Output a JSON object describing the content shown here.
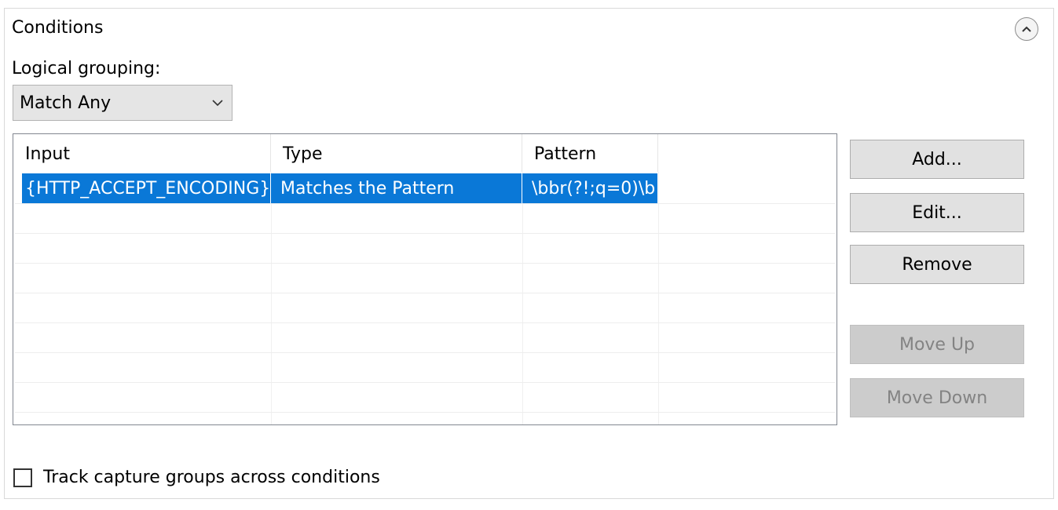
{
  "panel": {
    "title": "Conditions"
  },
  "logical_grouping": {
    "label": "Logical grouping:",
    "selected": "Match Any"
  },
  "table": {
    "columns": [
      "Input",
      "Type",
      "Pattern"
    ],
    "rows": [
      [
        "{HTTP_ACCEPT_ENCODING}",
        "Matches the Pattern",
        "\\bbr(?!;q=0)\\b"
      ]
    ]
  },
  "buttons": {
    "add": "Add...",
    "edit": "Edit...",
    "remove": "Remove",
    "move_up": "Move Up",
    "move_down": "Move Down"
  },
  "track_capture": {
    "label": "Track capture groups across conditions",
    "checked": false
  },
  "icons": {
    "collapse": "chevron-up-icon",
    "dropdown": "chevron-down-icon"
  },
  "colors": {
    "selection": "#0a78d7"
  }
}
